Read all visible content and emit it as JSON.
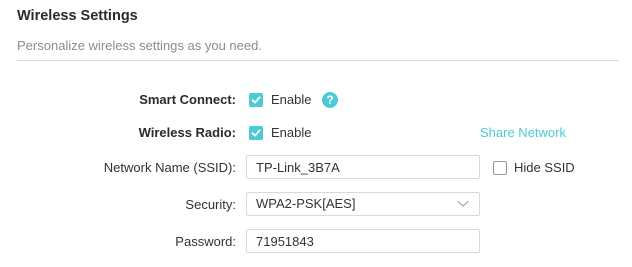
{
  "section": {
    "title": "Wireless Settings",
    "subtitle": "Personalize wireless settings as you need."
  },
  "smart_connect": {
    "label": "Smart Connect:",
    "checkbox_label": "Enable",
    "checked": true,
    "help_icon": "question-mark-icon"
  },
  "wireless_radio": {
    "label": "Wireless Radio:",
    "checkbox_label": "Enable",
    "checked": true,
    "share_link": "Share Network"
  },
  "network_name": {
    "label": "Network Name (SSID):",
    "value": "TP-Link_3B7A",
    "hide_ssid_label": "Hide SSID",
    "hide_ssid_checked": false
  },
  "security": {
    "label": "Security:",
    "selected": "WPA2-PSK[AES]"
  },
  "password": {
    "label": "Password:",
    "value": "71951843"
  },
  "colors": {
    "accent": "#4acbd6",
    "text": "#333333",
    "muted": "#8c8c8c",
    "border": "#d9d9d9"
  }
}
